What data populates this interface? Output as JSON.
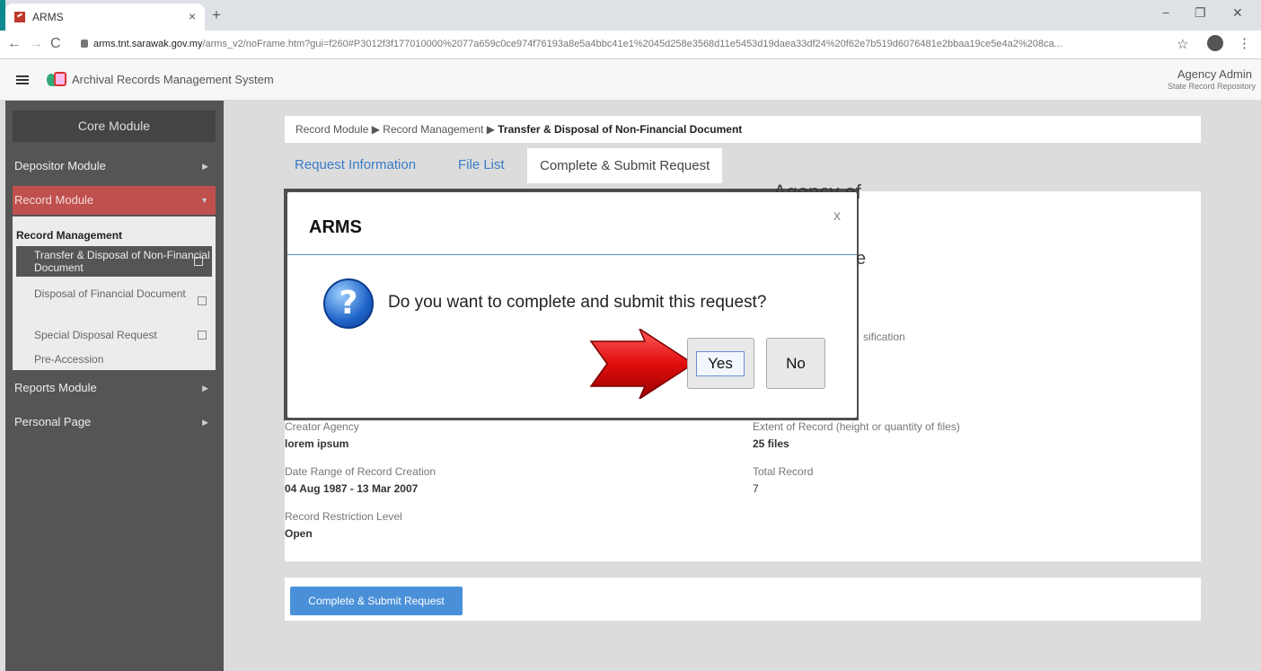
{
  "browser": {
    "tab_title": "ARMS",
    "tab_close": "×",
    "new_tab": "+",
    "win_min": "−",
    "win_max": "❐",
    "win_close": "✕",
    "nav_back": "←",
    "nav_forward": "→",
    "nav_reload": "C",
    "url_host": "arms.tnt.sarawak.gov.my",
    "url_path": "/arms_v2/noFrame.htm?gui=f260#P3012f3f177010000%2077a659c0ce974f76193a8e5a4bbc41e1%2045d258e3568d11e5453d19daea33df24%20f62e7b519d6076481e2bbaa19ce5e4a2%208ca...",
    "star": "☆",
    "menu": "⋮"
  },
  "app": {
    "title": "Archival Records Management System",
    "user_name": "Agency Admin",
    "user_role": "State Record Repository"
  },
  "sidebar": {
    "core_module": "Core Module",
    "depositor_module": "Depositor Module",
    "record_module": "Record Module",
    "record_management": "Record Management",
    "sub_items": [
      "Transfer & Disposal of Non-Financial Document",
      "Disposal of Financial Document",
      "Special Disposal Request",
      "Pre-Accession"
    ],
    "reports_module": "Reports Module",
    "personal_page": "Personal Page"
  },
  "main": {
    "breadcrumb_1": "Record Module",
    "breadcrumb_2": "Record Management",
    "breadcrumb_3": "Transfer & Disposal of Non-Financial Document",
    "tabs": [
      "Request Information",
      "File List",
      "Complete & Submit Request"
    ],
    "partial_agency": "Agency of",
    "partial_e": "e",
    "partial_classification": "sification",
    "creator_agency_label": "Creator Agency",
    "creator_agency_value": "lorem ipsum",
    "extent_label": "Extent of Record (height or quantity of files)",
    "extent_value": "25 files",
    "date_range_label": "Date Range of Record Creation",
    "date_range_value": "04 Aug 1987 - 13 Mar 2007",
    "total_record_label": "Total Record",
    "total_record_value": "7",
    "restriction_label": "Record Restriction Level",
    "restriction_value": "Open",
    "submit_button": "Complete & Submit Request"
  },
  "modal": {
    "title": "ARMS",
    "close": "x",
    "icon_glyph": "?",
    "message": "Do you want to complete and submit this request?",
    "yes": "Yes",
    "no": "No"
  },
  "colors": {
    "accent_blue": "#4a90d9",
    "record_module_red": "#c0504d",
    "sidebar_dark": "#555555",
    "arrow_red": "#e01010"
  }
}
